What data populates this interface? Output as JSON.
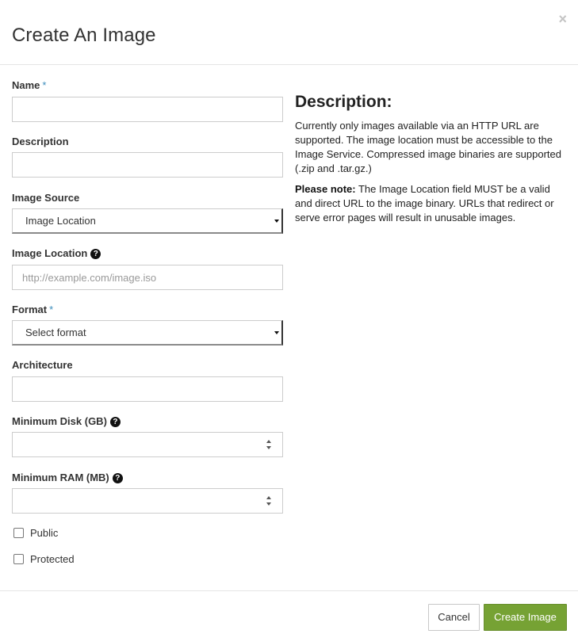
{
  "modal": {
    "title": "Create An Image",
    "close_glyph": "×"
  },
  "form": {
    "name": {
      "label": "Name",
      "required_mark": "*",
      "value": ""
    },
    "description": {
      "label": "Description",
      "value": ""
    },
    "image_source": {
      "label": "Image Source",
      "selected": "Image Location"
    },
    "image_location": {
      "label": "Image Location",
      "placeholder": "http://example.com/image.iso",
      "help_glyph": "?"
    },
    "format": {
      "label": "Format",
      "required_mark": "*",
      "selected": "Select format"
    },
    "architecture": {
      "label": "Architecture",
      "value": ""
    },
    "min_disk": {
      "label": "Minimum Disk (GB)",
      "help_glyph": "?",
      "value": ""
    },
    "min_ram": {
      "label": "Minimum RAM (MB)",
      "help_glyph": "?",
      "value": ""
    },
    "public": {
      "label": "Public",
      "checked": false
    },
    "protected": {
      "label": "Protected",
      "checked": false
    }
  },
  "description_panel": {
    "heading": "Description:",
    "paragraph1": "Currently only images available via an HTTP URL are supported. The image location must be accessible to the Image Service. Compressed image binaries are supported (.zip and .tar.gz.)",
    "note_label": "Please note:",
    "note_text": " The Image Location field MUST be a valid and direct URL to the image binary. URLs that redirect or serve error pages will result in unusable images."
  },
  "footer": {
    "cancel_label": "Cancel",
    "create_label": "Create Image"
  },
  "colors": {
    "required_mark": "#3c8dbc",
    "primary_button": "#76a234",
    "close_icon": "#c4c4c4"
  },
  "icons": {
    "close": "close-icon",
    "help": "question-circle-icon",
    "select_caret": "caret-down-icon",
    "spinner": "spinner-arrows-icon"
  }
}
